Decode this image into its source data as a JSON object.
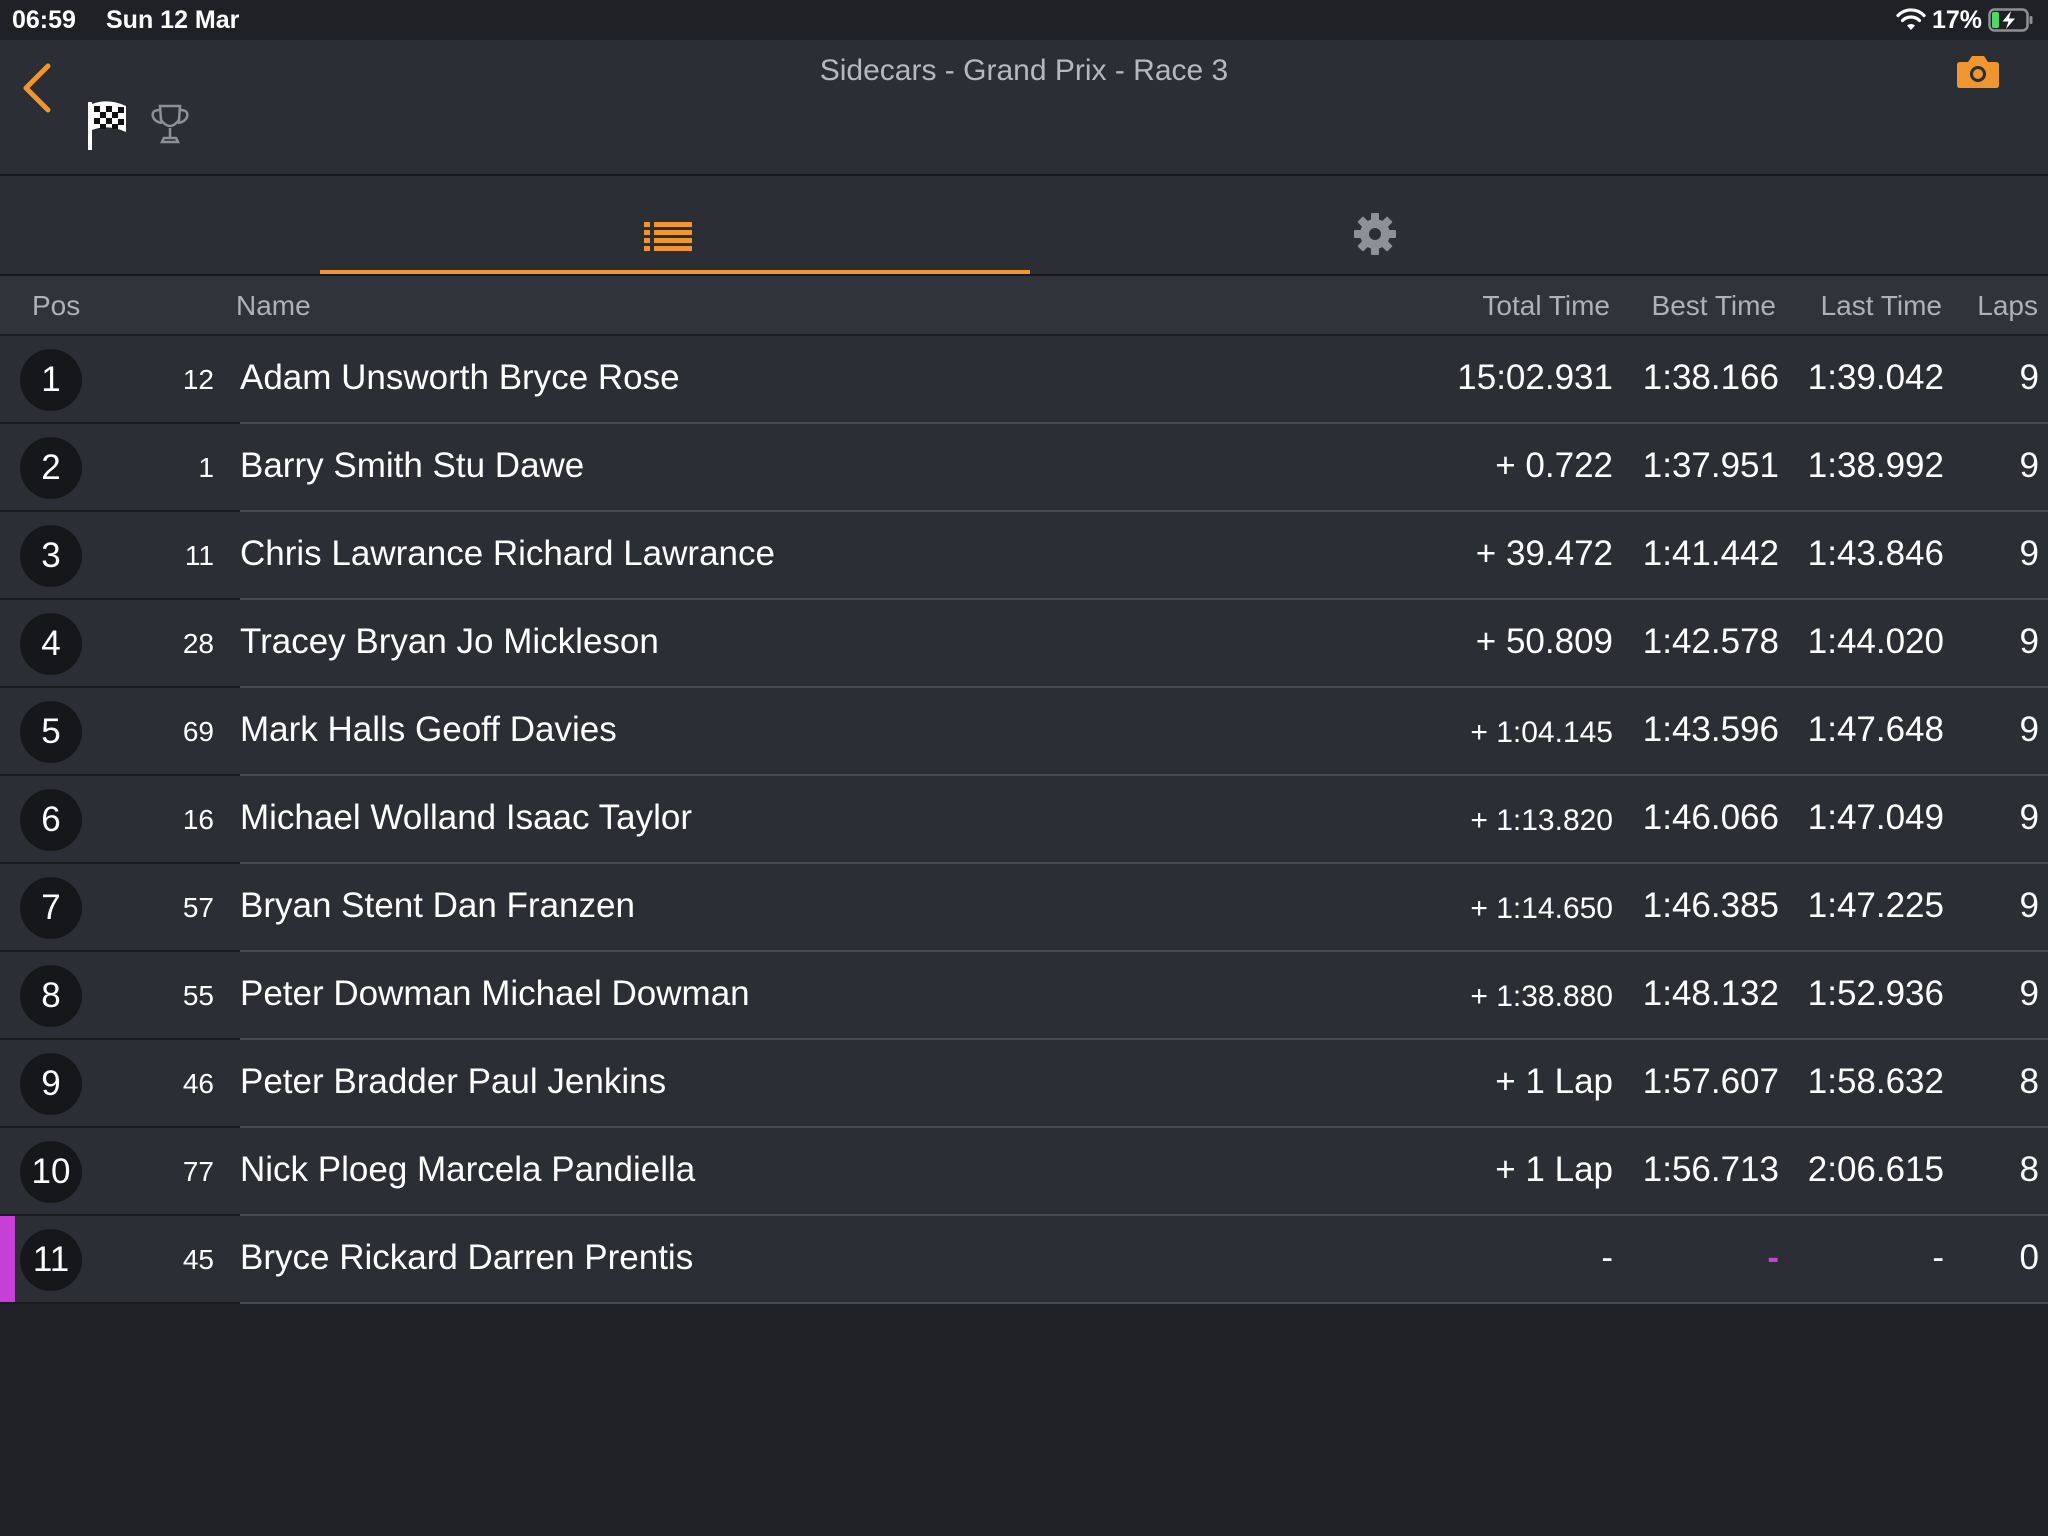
{
  "status_bar": {
    "time": "06:59",
    "date": "Sun 12 Mar",
    "battery": "17%"
  },
  "header": {
    "title": "Sidecars - Grand Prix - Race 3"
  },
  "colors": {
    "accent": "#f0962f",
    "background": "#1f2127",
    "row_background": "#2b2e35",
    "highlight_purple": "#c63fd6"
  },
  "table": {
    "columns": {
      "pos": "Pos",
      "name": "Name",
      "total": "Total Time",
      "best": "Best Time",
      "last": "Last Time",
      "laps": "Laps"
    },
    "rows": [
      {
        "pos": "1",
        "num": "12",
        "name": "Adam Unsworth Bryce  Rose",
        "total": "15:02.931",
        "best": "1:38.166",
        "last": "1:39.042",
        "laps": "9"
      },
      {
        "pos": "2",
        "num": "1",
        "name": "Barry Smith Stu Dawe",
        "total": "+ 0.722",
        "best": "1:37.951",
        "last": "1:38.992",
        "laps": "9"
      },
      {
        "pos": "3",
        "num": "11",
        "name": "Chris Lawrance Richard Lawrance",
        "total": "+ 39.472",
        "best": "1:41.442",
        "last": "1:43.846",
        "laps": "9"
      },
      {
        "pos": "4",
        "num": "28",
        "name": "Tracey Bryan Jo Mickleson",
        "total": "+ 50.809",
        "best": "1:42.578",
        "last": "1:44.020",
        "laps": "9"
      },
      {
        "pos": "5",
        "num": "69",
        "name": "Mark Halls Geoff Davies",
        "total": "+ 1:04.145",
        "best": "1:43.596",
        "last": "1:47.648",
        "laps": "9"
      },
      {
        "pos": "6",
        "num": "16",
        "name": "Michael Wolland Isaac Taylor",
        "total": "+ 1:13.820",
        "best": "1:46.066",
        "last": "1:47.049",
        "laps": "9"
      },
      {
        "pos": "7",
        "num": "57",
        "name": "Bryan Stent Dan Franzen",
        "total": "+ 1:14.650",
        "best": "1:46.385",
        "last": "1:47.225",
        "laps": "9"
      },
      {
        "pos": "8",
        "num": "55",
        "name": "Peter Dowman Michael Dowman",
        "total": "+ 1:38.880",
        "best": "1:48.132",
        "last": "1:52.936",
        "laps": "9"
      },
      {
        "pos": "9",
        "num": "46",
        "name": "Peter Bradder Paul Jenkins",
        "total": "+ 1 Lap",
        "best": "1:57.607",
        "last": "1:58.632",
        "laps": "8"
      },
      {
        "pos": "10",
        "num": "77",
        "name": "Nick Ploeg Marcela  Pandiella",
        "total": "+ 1 Lap",
        "best": "1:56.713",
        "last": "2:06.615",
        "laps": "8"
      },
      {
        "pos": "11",
        "num": "45",
        "name": "Bryce Rickard Darren Prentis",
        "total": "-",
        "best": "-",
        "last": "-",
        "laps": "0"
      }
    ]
  }
}
